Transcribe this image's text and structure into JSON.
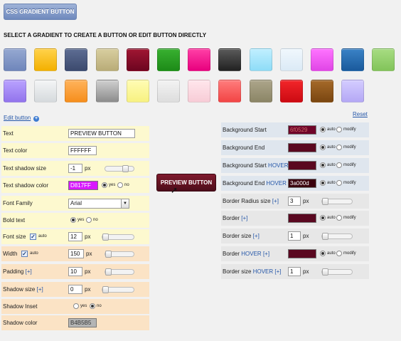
{
  "top_button": {
    "label": "CSS GRADIENT BUTTON"
  },
  "heading": "SELECT A GRADIENT TO CREATE A BUTTON OR EDIT BUTTON DIRECTLY",
  "swatches": [
    [
      "#95a8d1",
      "#6f86bb"
    ],
    [
      "#ffd24a",
      "#f3b000"
    ],
    [
      "#5d6d93",
      "#3c4a6e"
    ],
    [
      "#d8ce9f",
      "#b9ac78"
    ],
    [
      "#a01632",
      "#6d0520"
    ],
    [
      "#38b030",
      "#1d8b18"
    ],
    [
      "#ff3fa6",
      "#e8007e"
    ],
    [
      "#5a5a5a",
      "#222222"
    ],
    [
      "#c0efff",
      "#8edcf7"
    ],
    [
      "#f0f7fd",
      "#dbeaf6"
    ],
    [
      "#ff73ff",
      "#e046e6"
    ],
    [
      "#3a82c6",
      "#1a5a9c"
    ],
    [
      "#a7dc82",
      "#82c45a"
    ],
    [
      "#b9a2ff",
      "#9274ec"
    ],
    [
      "#f4f5f6",
      "#d6dadd"
    ],
    [
      "#ffb35c",
      "#f68e1c"
    ],
    [
      "#cfcfcf",
      "#8c8c8c"
    ],
    [
      "#fffcb3",
      "#f7f181"
    ],
    [
      "#f3f3f3",
      "#dddddd"
    ],
    [
      "#ffe6ec",
      "#f7ccd6"
    ],
    [
      "#ff7c7c",
      "#f24545"
    ],
    [
      "#aca58a",
      "#8b8566"
    ],
    [
      "#f2262a",
      "#cc0a12"
    ],
    [
      "#a56a2a",
      "#7a4610"
    ],
    [
      "#d4ccff",
      "#b4a8f5"
    ]
  ],
  "links": {
    "edit_button": "Edit button",
    "reset": "Reset"
  },
  "left_panel": {
    "text_label": "Text",
    "text_value": "PREVIEW BUTTON",
    "text_color_label": "Text color",
    "text_color_value": "FFFFFF",
    "text_shadow_size_label": "Text shadow size",
    "text_shadow_size_value": "-1",
    "text_shadow_color_label": "Text shadow color",
    "text_shadow_color_value": "D817FF",
    "font_family_label": "Font Family",
    "font_family_value": "Arial",
    "bold_text_label": "Bold text",
    "font_size_label": "Font size",
    "font_size_value": "12",
    "width_label": "Width",
    "width_value": "150",
    "padding_label": "Padding",
    "padding_value": "10",
    "shadow_size_label": "Shadow size",
    "shadow_size_value": "0",
    "shadow_inset_label": "Shadow Inset",
    "shadow_color_label": "Shadow color",
    "shadow_color_value": "B4B5B5"
  },
  "right_panel": {
    "bg_start_label": "Background Start",
    "bg_start_value": "6f0529",
    "bg_end_label": "Background End",
    "bg_end_value": "",
    "bg_start_hover_label": "Background Start",
    "bg_end_hover_label": "Background End",
    "bg_start_hover_value": "",
    "bg_end_hover_value": "3a000d",
    "border_radius_label": "Border Radius size",
    "border_radius_value": "3",
    "border_label": "Border",
    "border_value": "",
    "border_size_label": "Border size",
    "border_size_value": "1",
    "border_hover_label": "Border",
    "border_hover_value": "",
    "border_size_hover_label": "Border size",
    "border_size_hover_value": "1"
  },
  "common": {
    "px": "px",
    "yes": "yes",
    "no": "no",
    "auto": "auto",
    "modify": "modify",
    "plus": "[+]",
    "hover": "HOVER",
    "check": "✓"
  },
  "preview": {
    "label": "PREVIEW BUTTON"
  },
  "colors": {
    "yellow_row": "#fdf9cf",
    "orange_row": "#fbe3c5",
    "blue_row": "#dfe6ee",
    "grey_row": "#e7e7e7",
    "preview_bg": "#6f0529"
  },
  "sliders": {
    "text_shadow_size": 0.76,
    "font_size": 0.0,
    "width": 0.0,
    "padding": 0.0,
    "shadow_size": 0.0,
    "border_radius": 0.0,
    "border_size": 0.0,
    "border_size_hover": 0.0
  }
}
